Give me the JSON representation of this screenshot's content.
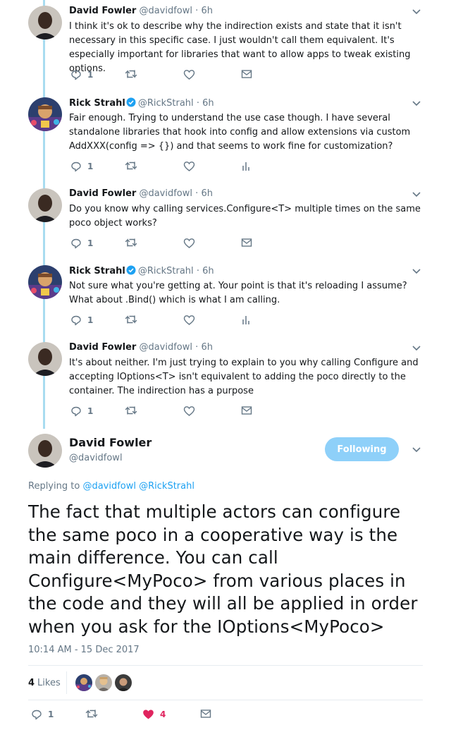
{
  "thread": [
    {
      "author_name": "David Fowler",
      "handle": "@davidfowl",
      "separator": "·",
      "time": "6h",
      "verified": false,
      "text": "I think it's ok to describe why the indirection exists and state that it isn't necessary in this specific case. I just wouldn't call them equivalent. It's especially important for libraries that want to allow apps to tweak existing options.",
      "reply_count": "1",
      "last_action_icon": "mail-icon"
    },
    {
      "author_name": "Rick Strahl",
      "handle": "@RickStrahl",
      "separator": "·",
      "time": "6h",
      "verified": true,
      "text": "Fair enough. Trying to understand the use case though. I have several standalone libraries that hook into config and allow extensions via custom AddXXX(config => {}) and that seems to work fine for customization?",
      "reply_count": "1",
      "last_action_icon": "analytics-icon"
    },
    {
      "author_name": "David Fowler",
      "handle": "@davidfowl",
      "separator": "·",
      "time": "6h",
      "verified": false,
      "text": "Do you know why calling services.Configure<T> multiple times on the same poco object works?",
      "reply_count": "1",
      "last_action_icon": "mail-icon"
    },
    {
      "author_name": "Rick Strahl",
      "handle": "@RickStrahl",
      "separator": "·",
      "time": "6h",
      "verified": true,
      "text": "Not sure what you're getting at. Your point is that it's reloading I assume? What about .Bind() which is what I am calling.",
      "reply_count": "1",
      "last_action_icon": "analytics-icon"
    },
    {
      "author_name": "David Fowler",
      "handle": "@davidfowl",
      "separator": "·",
      "time": "6h",
      "verified": false,
      "text": "It's about neither. I'm just trying to explain to you why calling Configure and accepting IOptions<T> isn't equivalent to adding the poco directly to the container. The indirection has a purpose",
      "reply_count": "1",
      "last_action_icon": "mail-icon"
    }
  ],
  "main_tweet": {
    "author_name": "David Fowler",
    "handle": "@davidfowl",
    "follow_label": "Following",
    "replying_prefix": "Replying to",
    "replying_mentions": [
      "@davidfowl",
      "@RickStrahl"
    ],
    "text": "The fact that multiple actors can configure the same poco in a cooperative way is the main difference. You can call Configure<MyPoco> from various places in the code and they will all be applied in order when you ask for the IOptions<MyPoco>",
    "timestamp": "10:14 AM - 15 Dec 2017",
    "likes_count": "4",
    "likes_label": "Likes",
    "reply_count": "1",
    "heart_count": "4"
  },
  "colors": {
    "thread_line": "#a8dcf0",
    "link": "#1da1f2",
    "muted": "#657786",
    "heart": "#e0245e",
    "follow_button": "#8ed0f9"
  }
}
